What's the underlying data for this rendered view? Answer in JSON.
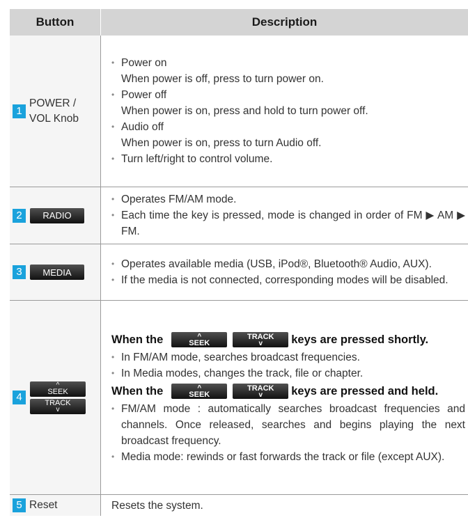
{
  "header": {
    "col_button": "Button",
    "col_description": "Description"
  },
  "rows": [
    {
      "num": "1",
      "label_line1": "POWER /",
      "label_line2": "VOL Knob",
      "bullets": [
        {
          "title": "Power on",
          "detail": "When power is off, press to turn power on."
        },
        {
          "title": "Power off",
          "detail": "When power is on, press and hold to turn power off."
        },
        {
          "title": "Audio off",
          "detail": "When power is on, press to turn Audio off."
        },
        {
          "title": "Turn left/right to control volume."
        }
      ]
    },
    {
      "num": "2",
      "key_label": "RADIO",
      "bullets": [
        "Operates FM/AM mode.",
        "Each time the key is pressed, mode is changed in order of FM ▶ AM ▶ FM."
      ]
    },
    {
      "num": "3",
      "key_label": "MEDIA",
      "bullets": [
        "Operates available media (USB, iPod®, Bluetooth® Audio, AUX).",
        "If the media is not connected, corresponding modes will be disabled."
      ]
    },
    {
      "num": "4",
      "seek_label": "SEEK",
      "track_label": "TRACK",
      "heading_prefix": "When the",
      "heading_short_suffix": "keys are pressed shortly.",
      "heading_held_suffix": "keys are pressed and held.",
      "short_bullets": [
        "In FM/AM mode, searches broadcast frequencies.",
        "In Media modes, changes the track, file or chapter."
      ],
      "held_bullets": [
        "FM/AM mode : automatically searches broadcast frequencies and channels. Once released, searches and begins playing the next broadcast frequency.",
        "Media mode: rewinds or fast forwards the track or file (except AUX)."
      ]
    },
    {
      "num": "5",
      "label": "Reset",
      "description": "Resets the system."
    }
  ],
  "glyphs": {
    "bullet": "•",
    "up_arrow": "^",
    "down_arrow": "v"
  },
  "colors": {
    "number_badge": "#1aa2dc",
    "header_bg": "#d4d4d4",
    "button_col_bg": "#f5f5f5",
    "key_bg": "#222222"
  }
}
